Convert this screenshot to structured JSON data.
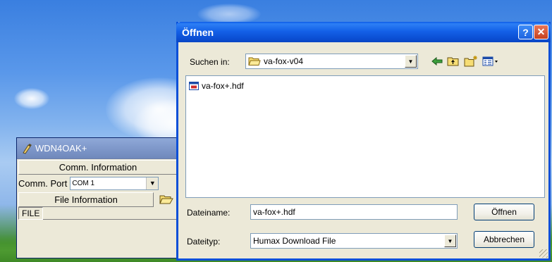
{
  "tool_window": {
    "title": "WDN4OAK+",
    "comm_header": "Comm. Information",
    "port_label": "Comm. Port",
    "port_value": "COM 1",
    "file_header": "File Information",
    "file_label": "FILE"
  },
  "dialog": {
    "title": "Öffnen",
    "help_symbol": "?",
    "close_symbol": "✕",
    "lookin_label": "Suchen in:",
    "lookin_value": "va-fox-v04",
    "files": [
      {
        "name": "va-fox+.hdf",
        "icon": "hdf-file-icon"
      }
    ],
    "filename_label": "Dateiname:",
    "filename_value": "va-fox+.hdf",
    "filetype_label": "Dateityp:",
    "filetype_value": "Humax Download File",
    "open_button": "Öffnen",
    "cancel_button": "Abbrechen"
  },
  "colors": {
    "xp_title_blue": "#0b4fd4",
    "dialog_face": "#ece9d8",
    "close_red": "#c5411e"
  }
}
